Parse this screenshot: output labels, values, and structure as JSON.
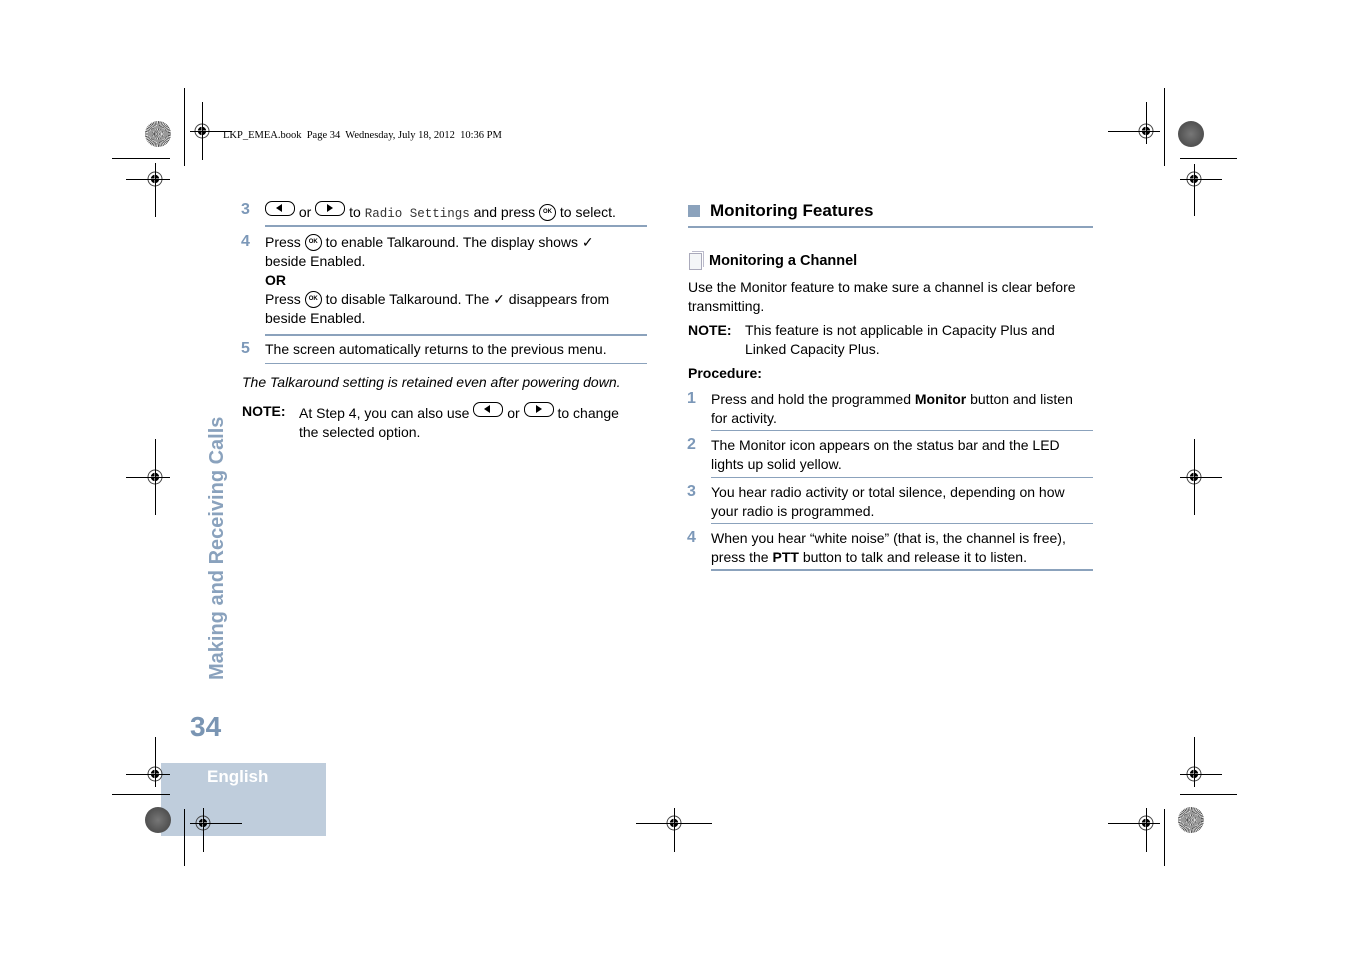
{
  "print_header": {
    "text": "LKP_EMEA.book  Page 34  Wednesday, July 18, 2012  10:36 PM"
  },
  "side_tab": {
    "chapter_title": "Making and Receiving Calls",
    "page_number": "34",
    "language": "English"
  },
  "left_column": {
    "steps": [
      {
        "number": "3",
        "parts": {
          "or": "or",
          "to": "to",
          "menu_item": "Radio Settings",
          "and_press": "and press",
          "to_select": "to select."
        }
      },
      {
        "number": "4",
        "press": "Press",
        "line1": "to enable Talkaround. The display shows ✓",
        "line2": "beside Enabled.",
        "or_label": "OR",
        "press2": "Press",
        "line3": "to disable Talkaround. The ✓ disappears from",
        "line4": "beside Enabled."
      },
      {
        "number": "5",
        "text": "The screen automatically returns to the previous menu."
      }
    ],
    "italic_note": "The Talkaround setting is retained even after powering down.",
    "note": {
      "label": "NOTE:",
      "line1_a": "At Step 4, you can also use",
      "line1_or": "or",
      "line1_b": "to change",
      "line2": "the selected option."
    }
  },
  "right_column": {
    "section_title": "Monitoring Features",
    "subsection_title": "Monitoring a Channel",
    "intro_line1": "Use the Monitor feature to make sure a channel is clear before",
    "intro_line2": "transmitting.",
    "note": {
      "label": "NOTE:",
      "line1": "This feature is not applicable in Capacity Plus and",
      "line2": "Linked Capacity Plus."
    },
    "procedure_label": "Procedure:",
    "steps": [
      {
        "number": "1",
        "l1_a": "Press and hold the programmed ",
        "l1_bold": "Monitor",
        "l1_b": " button and listen",
        "l2": "for activity."
      },
      {
        "number": "2",
        "l1": "The Monitor icon appears on the status bar and the LED",
        "l2": "lights up solid yellow."
      },
      {
        "number": "3",
        "l1": "You hear radio activity or total silence, depending on how",
        "l2": "your radio is programmed."
      },
      {
        "number": "4",
        "l1": "When you hear “white noise” (that is, the channel is free),",
        "l2_a": "press the ",
        "l2_bold": "PTT",
        "l2_b": " button to talk and release it to listen."
      }
    ]
  },
  "icons": {
    "left_button": "left-arrow-button-icon",
    "right_button": "right-arrow-button-icon",
    "ok_button": "ok-button-icon",
    "ok_label": "OK"
  },
  "colors": {
    "accent": "#8ba2bc",
    "step_number": "#7c98b8",
    "side_title": "#8aa2bd",
    "language_box": "#bfcddc"
  }
}
